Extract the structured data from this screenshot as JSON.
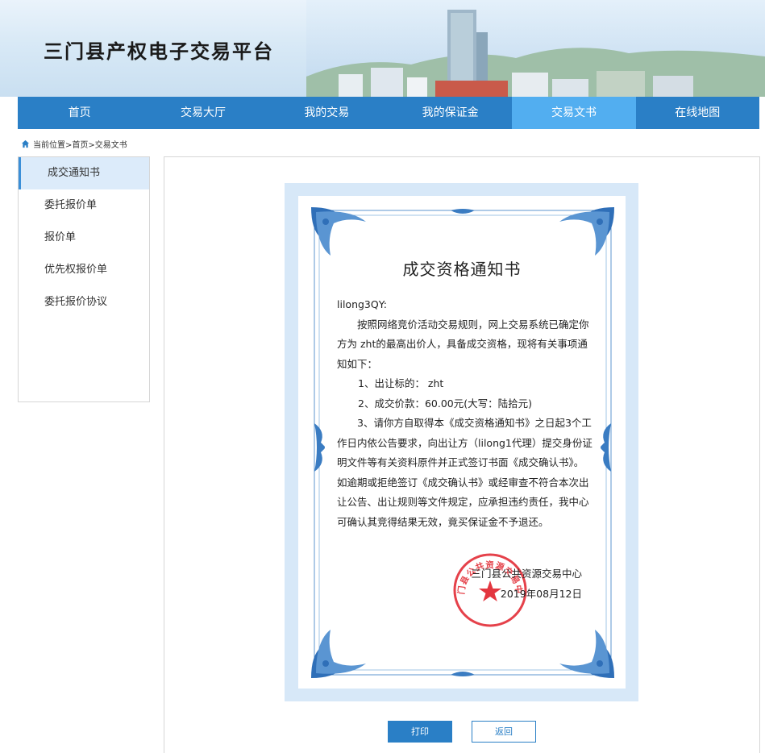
{
  "header": {
    "site_title": "三门县产权电子交易平台"
  },
  "nav": {
    "items": [
      {
        "label": "首页"
      },
      {
        "label": "交易大厅"
      },
      {
        "label": "我的交易"
      },
      {
        "label": "我的保证金"
      },
      {
        "label": "交易文书"
      },
      {
        "label": "在线地图"
      }
    ],
    "active": "交易文书"
  },
  "breadcrumb": {
    "text": "当前位置>首页>交易文书"
  },
  "sidebar": {
    "items": [
      {
        "label": "成交通知书"
      },
      {
        "label": "委托报价单"
      },
      {
        "label": "报价单"
      },
      {
        "label": "优先权报价单"
      },
      {
        "label": "委托报价协议"
      }
    ],
    "active": "成交通知书"
  },
  "certificate": {
    "title": "成交资格通知书",
    "recipient": "lilong3QY:",
    "intro": "按照网络竞价活动交易规则，网上交易系统已确定你方为 zht的最高出价人，具备成交资格，现将有关事项通知如下：",
    "item1": "1、出让标的： zht",
    "item2": "2、成交价款：60.00元(大写：陆拾元)",
    "item3": "3、请你方自取得本《成交资格通知书》之日起3个工作日内依公告要求，向出让方（lilong1代理）提交身份证明文件等有关资料原件并正式签订书面《成交确认书》。如逾期或拒绝签订《成交确认书》或经审查不符合本次出让公告、出让规则等文件规定，应承担违约责任，我中心可确认其竞得结果无效，竟买保证金不予退还。",
    "sign_org": "三门县公共资源交易中心",
    "sign_date": "2019年08月12日",
    "seal_text": "三门县公共资源交易中心"
  },
  "buttons": {
    "print_label": "打印",
    "back_label": "返回"
  },
  "colors": {
    "nav_bg": "#2a7fc6",
    "nav_active": "#52aef0",
    "sidebar_active": "#dcebfa",
    "cert_border": "#d7e8f8",
    "seal_red": "#e0202a"
  }
}
